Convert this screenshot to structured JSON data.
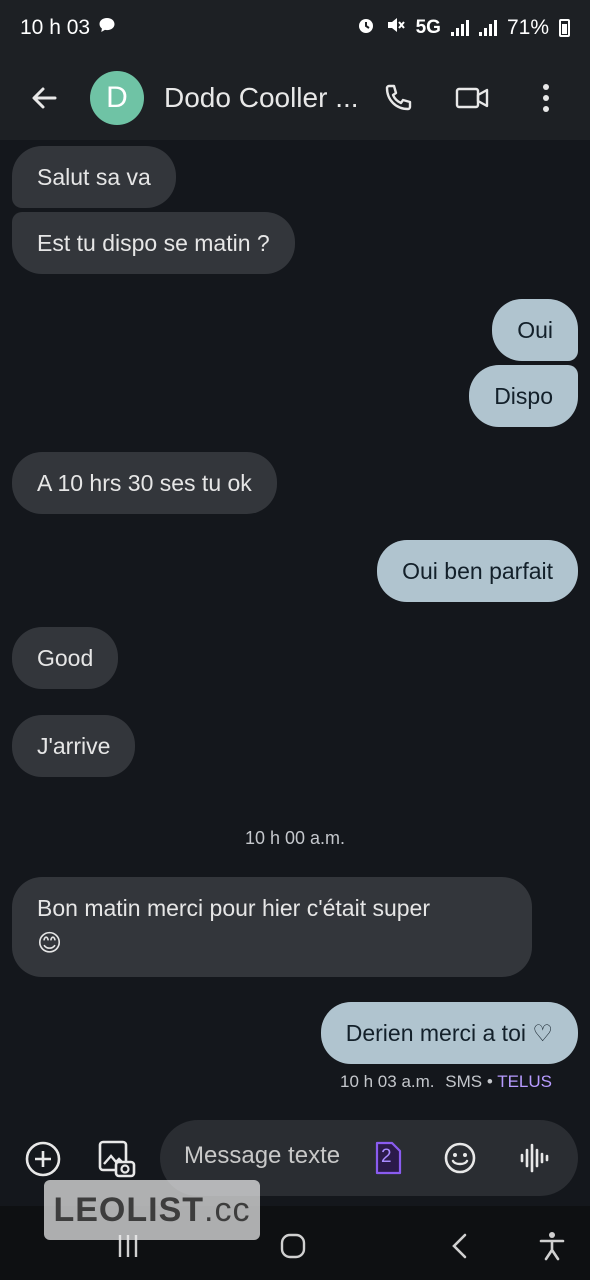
{
  "status_bar": {
    "time": "10 h 03",
    "network": "5G",
    "battery": "71%"
  },
  "header": {
    "avatar_letter": "D",
    "contact_name": "Dodo Cooller ...",
    "avatar_color": "#6fc3a5"
  },
  "messages": [
    {
      "direction": "in",
      "text": "Salut sa va"
    },
    {
      "direction": "in",
      "text": "Est tu dispo se matin ?"
    },
    {
      "direction": "out",
      "text": "Oui"
    },
    {
      "direction": "out",
      "text": "Dispo"
    },
    {
      "direction": "in",
      "text": "A 10 hrs 30 ses tu ok"
    },
    {
      "direction": "out",
      "text": "Oui ben parfait"
    },
    {
      "direction": "in",
      "text": "Good"
    },
    {
      "direction": "in",
      "text": "J'arrive"
    },
    {
      "direction": "in",
      "text": "Bon matin merci pour hier c'était super"
    },
    {
      "direction": "out",
      "text": "Derien merci a toi ♡"
    }
  ],
  "emoji": "😊",
  "timestamp_divider": "10 h 00 a.m.",
  "last_message_meta": {
    "time": "10 h 03 a.m.",
    "type": "SMS",
    "separator": "•",
    "carrier": "TELUS"
  },
  "composer": {
    "placeholder": "Message texte",
    "sim_badge": "2"
  },
  "watermark": {
    "brand": "LEOLIST",
    "domain": ".cc"
  },
  "colors": {
    "incoming_bubble": "#33363b",
    "outgoing_bubble": "#b0c4cf",
    "carrier_accent": "#b79bff",
    "sim_badge": "#7c4dcc"
  }
}
